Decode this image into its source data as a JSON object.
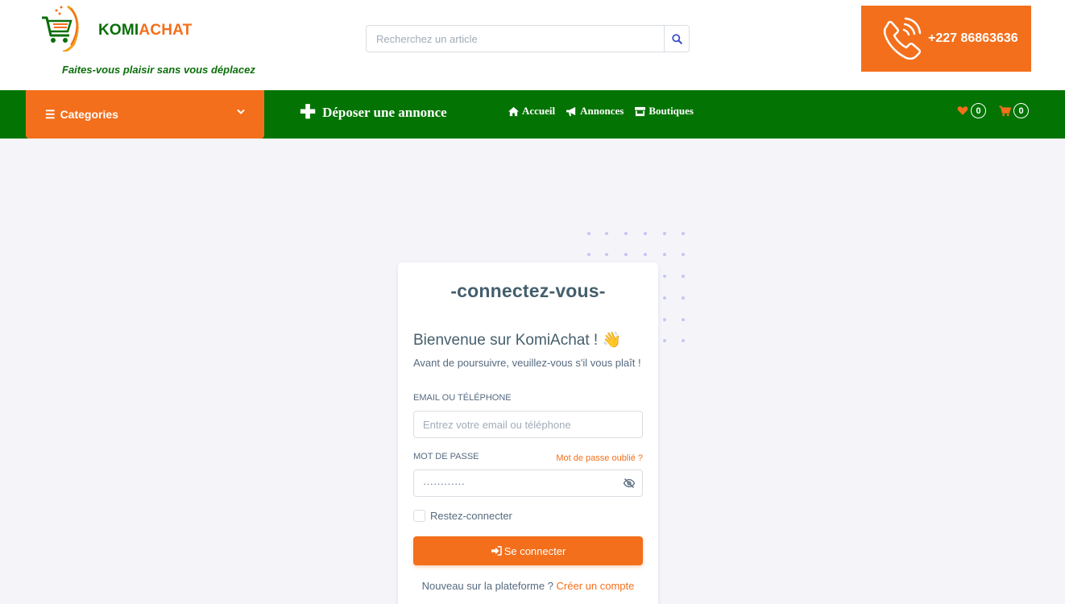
{
  "header": {
    "brand_part1": "KOMI",
    "brand_part2": "ACHAT",
    "tagline": "Faites-vous plaisir sans vous déplacez",
    "search_placeholder": "Recherchez un article",
    "search_icon": "search-icon",
    "phone": "+227 86863636",
    "phone_icon": "phone-ringing-icon"
  },
  "nav": {
    "categories_label": "Categories",
    "deposit_label": "Déposer une annonce",
    "menu": [
      {
        "label": "Accueil",
        "icon": "home-icon"
      },
      {
        "label": "Annonces",
        "icon": "bullhorn-icon"
      },
      {
        "label": "Boutiques",
        "icon": "store-icon"
      }
    ],
    "wishlist_count": "0",
    "cart_count": "0"
  },
  "login": {
    "title": "-connectez-vous-",
    "welcome": "Bienvenue sur KomiAchat ! 👋",
    "subtitle": "Avant de poursuivre, veuillez-vous s'il vous plaît !",
    "email_label": "EMAIL OU TÉLÉPHONE",
    "email_placeholder": "Entrez votre email ou téléphone",
    "password_label": "MOT DE PASSE",
    "forgot_link": "Mot de passe oublié ?",
    "password_value": "············",
    "remember_label": "Restez-connecter",
    "submit_label": "Se connecter",
    "signup_text": "Nouveau sur la plateforme ?",
    "signup_link": "Créer un compte"
  },
  "colors": {
    "brand_orange": "#f36f1b",
    "brand_green": "#037403",
    "dots": "#c5c6f5"
  }
}
